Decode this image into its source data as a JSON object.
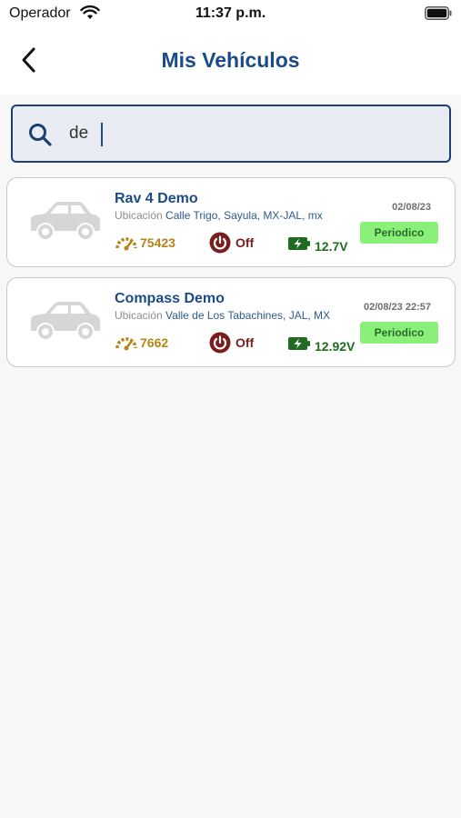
{
  "status_bar": {
    "carrier": "Operador",
    "time": "11:37 p.m.",
    "icons": [
      "wifi-icon",
      "battery-icon"
    ]
  },
  "nav": {
    "title": "Mis Vehículos",
    "back_icon": "chevron-left-icon"
  },
  "search": {
    "value": "de",
    "icon": "search-icon"
  },
  "vehicles": [
    {
      "name": "Rav 4 Demo",
      "location_label": "Ubicación",
      "location": "Calle Trigo, Sayula, MX-JAL, mx",
      "odometer": "75423",
      "power": "Off",
      "voltage": "12.7V",
      "date": "02/08/23",
      "badge": "Periodico"
    },
    {
      "name": "Compass Demo",
      "location_label": "Ubicación",
      "location": "Valle de Los Tabachines, JAL, MX",
      "odometer": "7662",
      "power": "Off",
      "voltage": "12.92V",
      "date": "02/08/23 22:57",
      "badge": "Periodico"
    }
  ],
  "colors": {
    "brand": "#1b4b86",
    "odometer": "#b58416",
    "power": "#7a1d1d",
    "voltage": "#1f6b1f",
    "badge_bg": "#8bf07a"
  }
}
